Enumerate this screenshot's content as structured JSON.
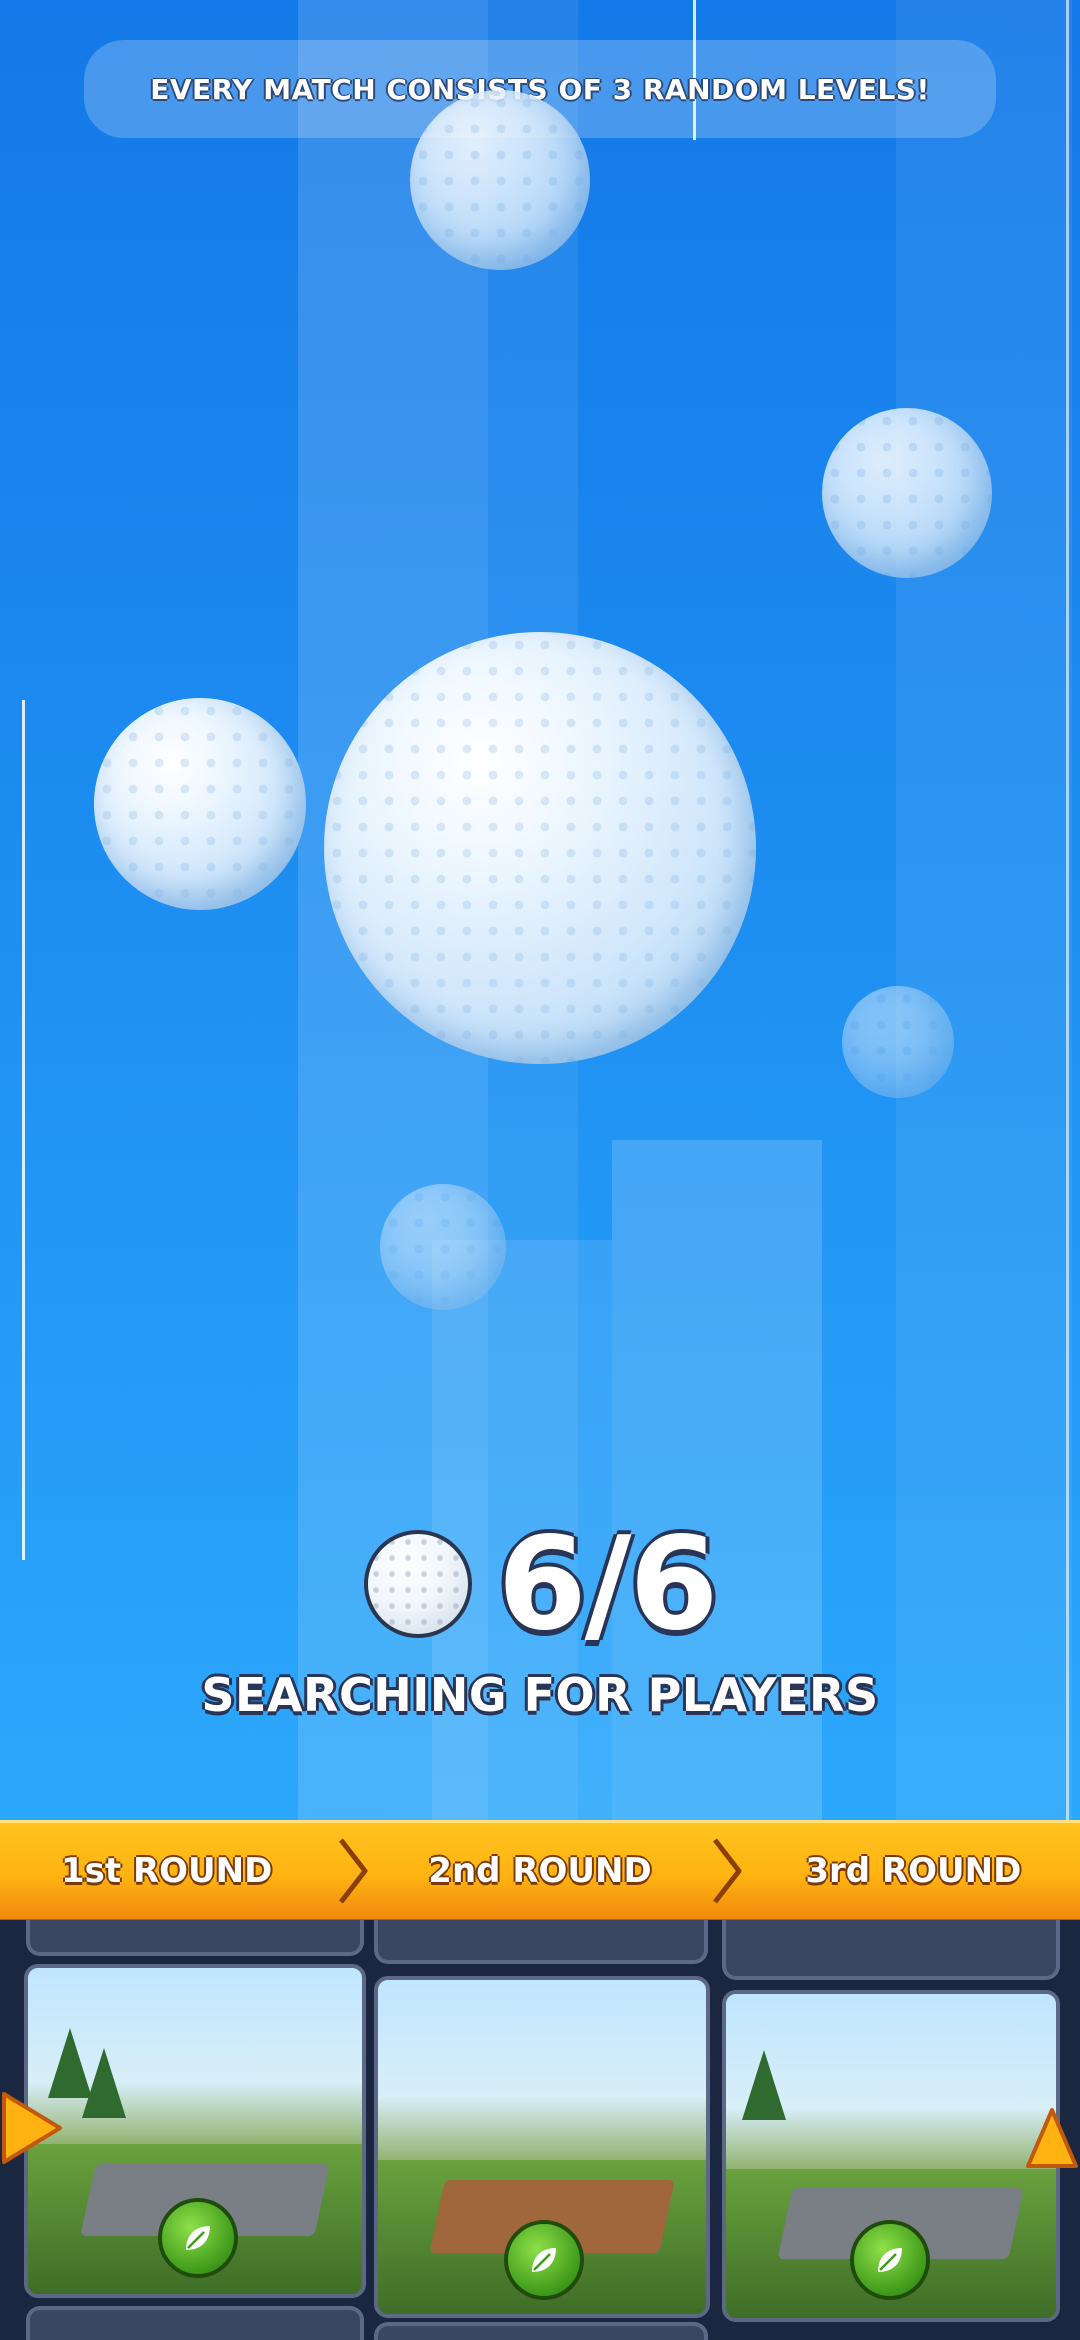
{
  "banner": {
    "text": "EVERY MATCH CONSISTS OF 3 RANDOM LEVELS!"
  },
  "matchmaking": {
    "player_count": "6/6",
    "status": "SEARCHING FOR PLAYERS"
  },
  "rounds": {
    "items": [
      {
        "label": "1st ROUND"
      },
      {
        "label": "2nd ROUND"
      },
      {
        "label": "3rd ROUND"
      }
    ]
  },
  "colors": {
    "background_top": "#1479e8",
    "background_bottom": "#34b2ff",
    "round_bar": "#ffb312",
    "levels_panel": "#1b2740"
  },
  "icons": [
    "golf-ball-icon",
    "chevron-right-icon",
    "leaf-icon",
    "arrow-left-icon",
    "arrow-up-icon"
  ]
}
